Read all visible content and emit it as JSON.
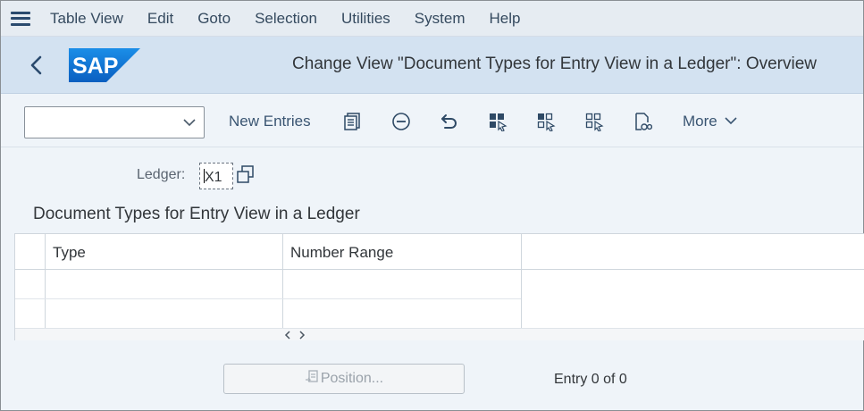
{
  "menubar": {
    "items": [
      {
        "label": "Table View"
      },
      {
        "label": "Edit"
      },
      {
        "label": "Goto"
      },
      {
        "label": "Selection"
      },
      {
        "label": "Utilities"
      },
      {
        "label": "System"
      },
      {
        "label": "Help"
      }
    ]
  },
  "titlebar": {
    "logo_text": "SAP",
    "title": "Change View \"Document Types for Entry View in a Ledger\": Overview"
  },
  "toolbar": {
    "command_value": "",
    "new_entries_label": "New Entries",
    "more_label": "More"
  },
  "ledger": {
    "label": "Ledger:",
    "value": "X1"
  },
  "section_title": "Document Types for Entry View in a Ledger",
  "table": {
    "columns": [
      "Type",
      "Number Range"
    ],
    "rows": [
      [
        "",
        ""
      ],
      [
        "",
        ""
      ]
    ]
  },
  "footer": {
    "position_label": "Position...",
    "entry_text": "Entry 0 of 0"
  },
  "colors": {
    "menubar_bg": "#e6ecf2",
    "titlebar_bg": "#d3e2f1",
    "sap_blue": "#0a6ed1",
    "page_bg": "#eff4f9"
  },
  "icons": [
    "menu-icon",
    "back-icon",
    "sap-logo",
    "chevron-down-icon",
    "details-icon",
    "delete-row-icon",
    "undo-icon",
    "select-all-icon",
    "select-block-icon",
    "deselect-all-icon",
    "print-icon",
    "chevron-down-icon",
    "multiple-selection-icon",
    "scroll-left-icon",
    "scroll-right-icon",
    "position-icon"
  ]
}
